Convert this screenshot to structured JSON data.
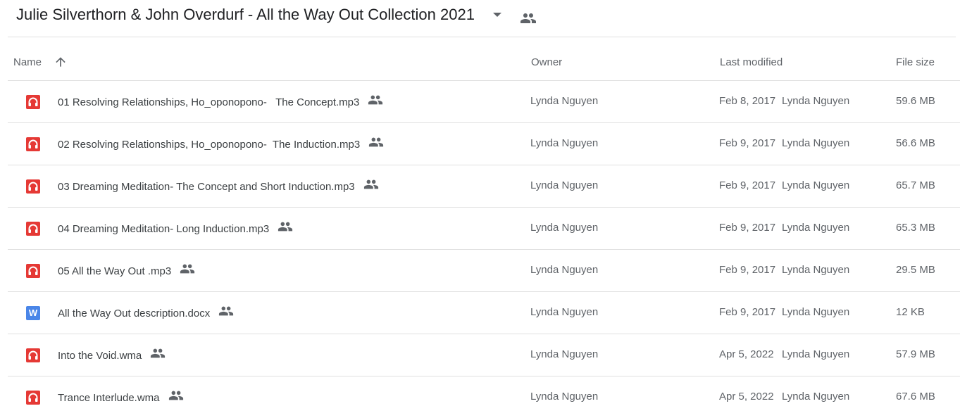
{
  "header": {
    "title": "Julie Silverthorn & John Overdurf - All the Way Out Collection 2021"
  },
  "columns": {
    "name": "Name",
    "owner": "Owner",
    "last_modified": "Last modified",
    "file_size": "File size"
  },
  "files": [
    {
      "name": "01 Resolving Relationships, Ho_oponopono-   The Concept.mp3",
      "type": "audio",
      "owner": "Lynda Nguyen",
      "modified_date": "Feb 8, 2017",
      "modified_by": "Lynda Nguyen",
      "size": "59.6 MB"
    },
    {
      "name": "02 Resolving Relationships, Ho_oponopono-  The Induction.mp3",
      "type": "audio",
      "owner": "Lynda Nguyen",
      "modified_date": "Feb 9, 2017",
      "modified_by": "Lynda Nguyen",
      "size": "56.6 MB"
    },
    {
      "name": "03 Dreaming Meditation- The Concept and Short Induction.mp3",
      "type": "audio",
      "owner": "Lynda Nguyen",
      "modified_date": "Feb 9, 2017",
      "modified_by": "Lynda Nguyen",
      "size": "65.7 MB"
    },
    {
      "name": "04 Dreaming Meditation- Long Induction.mp3",
      "type": "audio",
      "owner": "Lynda Nguyen",
      "modified_date": "Feb 9, 2017",
      "modified_by": "Lynda Nguyen",
      "size": "65.3 MB"
    },
    {
      "name": "05 All the Way Out .mp3",
      "type": "audio",
      "owner": "Lynda Nguyen",
      "modified_date": "Feb 9, 2017",
      "modified_by": "Lynda Nguyen",
      "size": "29.5 MB"
    },
    {
      "name": "All the Way Out description.docx",
      "type": "word",
      "owner": "Lynda Nguyen",
      "modified_date": "Feb 9, 2017",
      "modified_by": "Lynda Nguyen",
      "size": "12 KB"
    },
    {
      "name": "Into the Void.wma",
      "type": "audio",
      "owner": "Lynda Nguyen",
      "modified_date": "Apr 5, 2022",
      "modified_by": "Lynda Nguyen",
      "size": "57.9 MB"
    },
    {
      "name": "Trance Interlude.wma",
      "type": "audio",
      "owner": "Lynda Nguyen",
      "modified_date": "Apr 5, 2022",
      "modified_by": "Lynda Nguyen",
      "size": "67.6 MB"
    }
  ],
  "icons": {
    "audio": "headphones-icon",
    "word": "word-doc-icon",
    "shared": "people-icon",
    "sort": "arrow-up-icon",
    "dropdown": "caret-down-icon"
  },
  "word_icon_letter": "W",
  "colors": {
    "audio_icon": "#e53935",
    "word_icon": "#4a86e8",
    "text_primary": "#3c4043",
    "text_secondary": "#5f6368",
    "divider": "#e0e0e0"
  }
}
